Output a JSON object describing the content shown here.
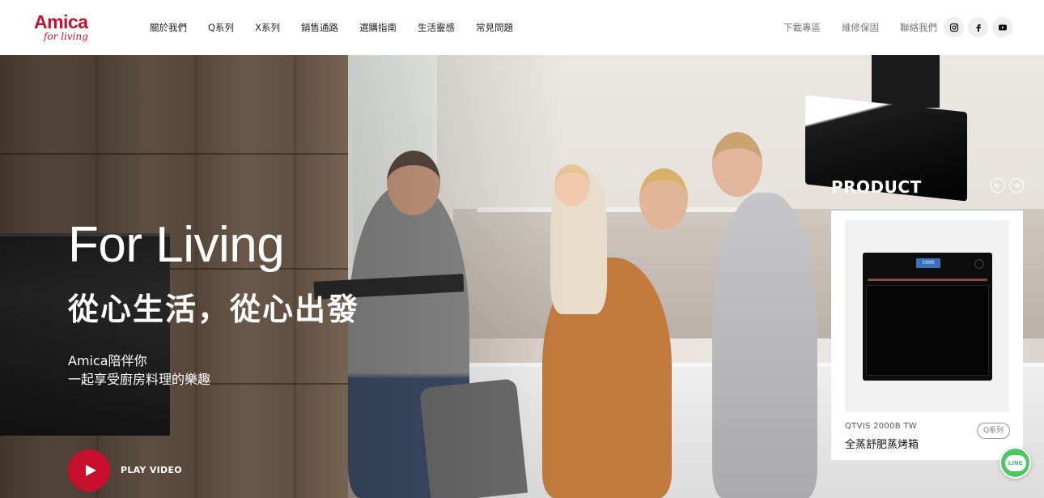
{
  "brand": {
    "name": "Amica",
    "tagline": "for living"
  },
  "nav": {
    "items": [
      "關於我們",
      "Q系列",
      "X系列",
      "銷售通路",
      "選購指南",
      "生活靈感",
      "常見問題"
    ]
  },
  "utility_links": [
    "下載專區",
    "維修保固",
    "聯絡我們"
  ],
  "social": [
    {
      "icon": "instagram-icon"
    },
    {
      "icon": "facebook-icon"
    },
    {
      "icon": "youtube-icon"
    }
  ],
  "hero": {
    "title": "For Living",
    "subtitle": "從心生活，從心出發",
    "desc_line1": "Amica陪伴你",
    "desc_line2": "一起享受廚房料理的樂趣",
    "play_label": "PLAY VIDEO"
  },
  "product": {
    "heading": "PRODUCT",
    "model": "QTVIS 2000B TW",
    "name": "全蒸舒肥蒸烤箱",
    "series": "Q系列",
    "oven_display": "1000"
  },
  "float": {
    "line_label": "LINE"
  },
  "colors": {
    "brand_red": "#c8102e",
    "line_green": "#4cc764"
  }
}
